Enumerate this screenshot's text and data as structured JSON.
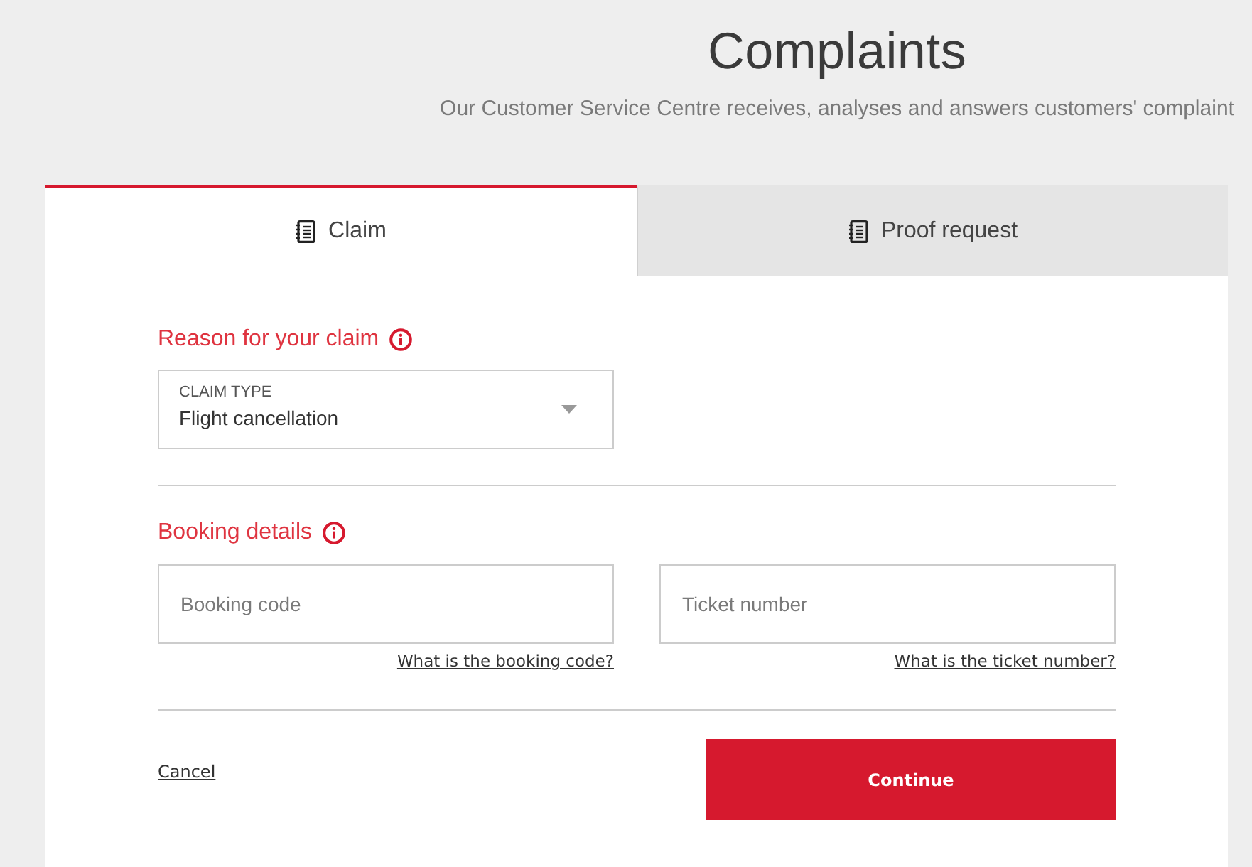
{
  "header": {
    "title": "Complaints",
    "subtitle": "Our Customer Service Centre receives, analyses and answers customers' complaint"
  },
  "tabs": [
    {
      "label": "Claim",
      "selected": true
    },
    {
      "label": "Proof request",
      "selected": false
    }
  ],
  "sections": [
    {
      "kind": "select",
      "heading": "Reason for your claim",
      "field": {
        "label": "CLAIM TYPE",
        "value": "Flight cancellation"
      }
    },
    {
      "kind": "inputs",
      "heading": "Booking details",
      "fields": [
        {
          "placeholder": "Booking code",
          "help_link": "What is the booking code?"
        },
        {
          "placeholder": "Ticket number",
          "help_link": "What is the ticket number?"
        }
      ]
    }
  ],
  "actions": {
    "cancel": "Cancel",
    "continue": "Continue"
  }
}
